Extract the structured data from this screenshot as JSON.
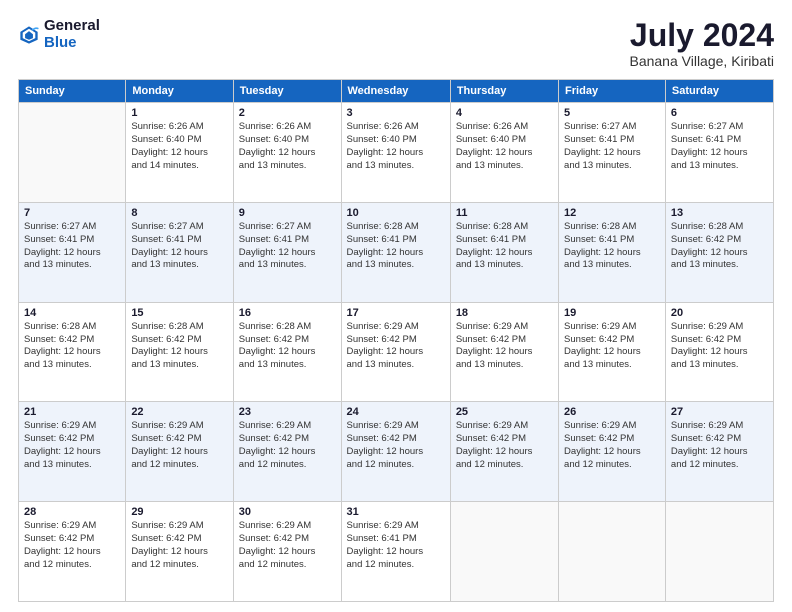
{
  "logo": {
    "general": "General",
    "blue": "Blue"
  },
  "title": {
    "month_year": "July 2024",
    "location": "Banana Village, Kiribati"
  },
  "headers": [
    "Sunday",
    "Monday",
    "Tuesday",
    "Wednesday",
    "Thursday",
    "Friday",
    "Saturday"
  ],
  "weeks": [
    [
      {
        "day": "",
        "info": ""
      },
      {
        "day": "1",
        "info": "Sunrise: 6:26 AM\nSunset: 6:40 PM\nDaylight: 12 hours\nand 14 minutes."
      },
      {
        "day": "2",
        "info": "Sunrise: 6:26 AM\nSunset: 6:40 PM\nDaylight: 12 hours\nand 13 minutes."
      },
      {
        "day": "3",
        "info": "Sunrise: 6:26 AM\nSunset: 6:40 PM\nDaylight: 12 hours\nand 13 minutes."
      },
      {
        "day": "4",
        "info": "Sunrise: 6:26 AM\nSunset: 6:40 PM\nDaylight: 12 hours\nand 13 minutes."
      },
      {
        "day": "5",
        "info": "Sunrise: 6:27 AM\nSunset: 6:41 PM\nDaylight: 12 hours\nand 13 minutes."
      },
      {
        "day": "6",
        "info": "Sunrise: 6:27 AM\nSunset: 6:41 PM\nDaylight: 12 hours\nand 13 minutes."
      }
    ],
    [
      {
        "day": "7",
        "info": "Sunrise: 6:27 AM\nSunset: 6:41 PM\nDaylight: 12 hours\nand 13 minutes."
      },
      {
        "day": "8",
        "info": "Sunrise: 6:27 AM\nSunset: 6:41 PM\nDaylight: 12 hours\nand 13 minutes."
      },
      {
        "day": "9",
        "info": "Sunrise: 6:27 AM\nSunset: 6:41 PM\nDaylight: 12 hours\nand 13 minutes."
      },
      {
        "day": "10",
        "info": "Sunrise: 6:28 AM\nSunset: 6:41 PM\nDaylight: 12 hours\nand 13 minutes."
      },
      {
        "day": "11",
        "info": "Sunrise: 6:28 AM\nSunset: 6:41 PM\nDaylight: 12 hours\nand 13 minutes."
      },
      {
        "day": "12",
        "info": "Sunrise: 6:28 AM\nSunset: 6:41 PM\nDaylight: 12 hours\nand 13 minutes."
      },
      {
        "day": "13",
        "info": "Sunrise: 6:28 AM\nSunset: 6:42 PM\nDaylight: 12 hours\nand 13 minutes."
      }
    ],
    [
      {
        "day": "14",
        "info": "Sunrise: 6:28 AM\nSunset: 6:42 PM\nDaylight: 12 hours\nand 13 minutes."
      },
      {
        "day": "15",
        "info": "Sunrise: 6:28 AM\nSunset: 6:42 PM\nDaylight: 12 hours\nand 13 minutes."
      },
      {
        "day": "16",
        "info": "Sunrise: 6:28 AM\nSunset: 6:42 PM\nDaylight: 12 hours\nand 13 minutes."
      },
      {
        "day": "17",
        "info": "Sunrise: 6:29 AM\nSunset: 6:42 PM\nDaylight: 12 hours\nand 13 minutes."
      },
      {
        "day": "18",
        "info": "Sunrise: 6:29 AM\nSunset: 6:42 PM\nDaylight: 12 hours\nand 13 minutes."
      },
      {
        "day": "19",
        "info": "Sunrise: 6:29 AM\nSunset: 6:42 PM\nDaylight: 12 hours\nand 13 minutes."
      },
      {
        "day": "20",
        "info": "Sunrise: 6:29 AM\nSunset: 6:42 PM\nDaylight: 12 hours\nand 13 minutes."
      }
    ],
    [
      {
        "day": "21",
        "info": "Sunrise: 6:29 AM\nSunset: 6:42 PM\nDaylight: 12 hours\nand 13 minutes."
      },
      {
        "day": "22",
        "info": "Sunrise: 6:29 AM\nSunset: 6:42 PM\nDaylight: 12 hours\nand 12 minutes."
      },
      {
        "day": "23",
        "info": "Sunrise: 6:29 AM\nSunset: 6:42 PM\nDaylight: 12 hours\nand 12 minutes."
      },
      {
        "day": "24",
        "info": "Sunrise: 6:29 AM\nSunset: 6:42 PM\nDaylight: 12 hours\nand 12 minutes."
      },
      {
        "day": "25",
        "info": "Sunrise: 6:29 AM\nSunset: 6:42 PM\nDaylight: 12 hours\nand 12 minutes."
      },
      {
        "day": "26",
        "info": "Sunrise: 6:29 AM\nSunset: 6:42 PM\nDaylight: 12 hours\nand 12 minutes."
      },
      {
        "day": "27",
        "info": "Sunrise: 6:29 AM\nSunset: 6:42 PM\nDaylight: 12 hours\nand 12 minutes."
      }
    ],
    [
      {
        "day": "28",
        "info": "Sunrise: 6:29 AM\nSunset: 6:42 PM\nDaylight: 12 hours\nand 12 minutes."
      },
      {
        "day": "29",
        "info": "Sunrise: 6:29 AM\nSunset: 6:42 PM\nDaylight: 12 hours\nand 12 minutes."
      },
      {
        "day": "30",
        "info": "Sunrise: 6:29 AM\nSunset: 6:42 PM\nDaylight: 12 hours\nand 12 minutes."
      },
      {
        "day": "31",
        "info": "Sunrise: 6:29 AM\nSunset: 6:41 PM\nDaylight: 12 hours\nand 12 minutes."
      },
      {
        "day": "",
        "info": ""
      },
      {
        "day": "",
        "info": ""
      },
      {
        "day": "",
        "info": ""
      }
    ]
  ]
}
